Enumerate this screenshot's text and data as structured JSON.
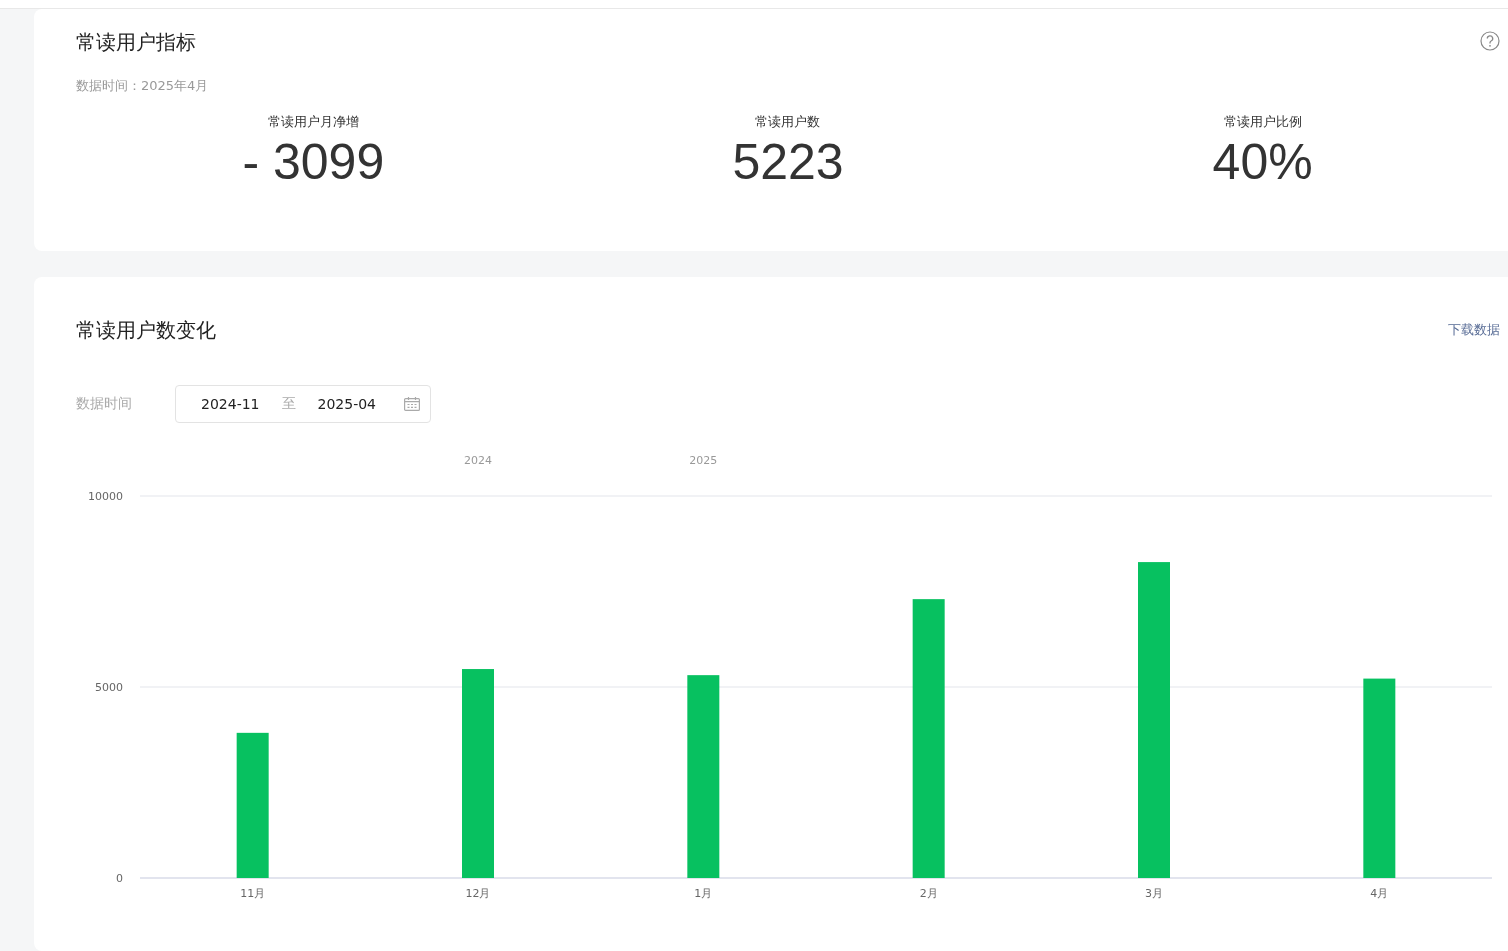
{
  "summary": {
    "title": "常读用户指标",
    "data_time": "数据时间：2025年4月",
    "metrics": [
      {
        "label": "常读用户月净增",
        "value": "- 3099"
      },
      {
        "label": "常读用户数",
        "value": "5223"
      },
      {
        "label": "常读用户比例",
        "value": "40%"
      }
    ]
  },
  "trend": {
    "title": "常读用户数变化",
    "download_link": "下载数据",
    "filter_label": "数据时间",
    "range_start": "2024-11",
    "range_separator": "至",
    "range_end": "2025-04",
    "chart_data": {
      "type": "bar",
      "categories": [
        "11月",
        "12月",
        "1月",
        "2月",
        "3月",
        "4月"
      ],
      "series": [
        {
          "color": "#07c160",
          "values": [
            3800,
            5470,
            5310,
            7300,
            8270,
            5220
          ]
        }
      ],
      "ylim": [
        0,
        10000
      ],
      "yticks": [
        0,
        5000,
        10000
      ],
      "annotations": [
        "2024",
        "2025"
      ]
    }
  }
}
